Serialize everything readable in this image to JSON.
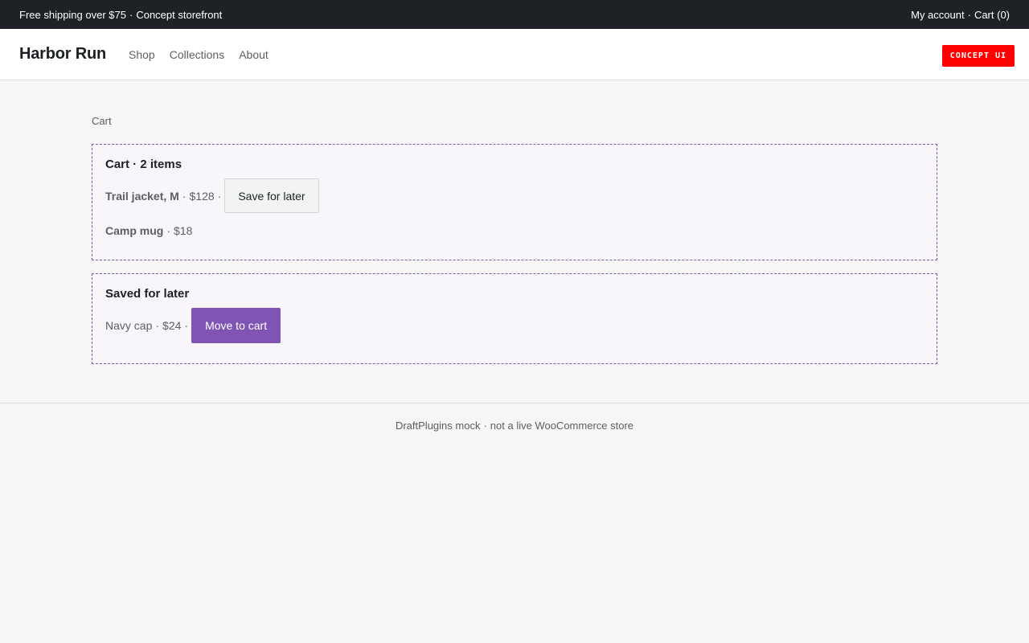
{
  "topbar": {
    "promo": "Free shipping over $75",
    "promo_sep": "·",
    "promo_tag": "Concept storefront",
    "account_link": "My account",
    "links_sep": "·",
    "cart_link": "Cart (0)"
  },
  "header": {
    "brand": "Harbor Run",
    "nav": [
      "Shop",
      "Collections",
      "About"
    ],
    "badge": "CONCEPT UI"
  },
  "breadcrumb": "Cart",
  "cart": {
    "title": "Cart · 2 items",
    "items": [
      {
        "name": "Trail jacket, M",
        "price": "$128",
        "action": "Save for later"
      },
      {
        "name": "Camp mug",
        "price": "$18"
      }
    ]
  },
  "saved": {
    "title": "Saved for later",
    "items": [
      {
        "name": "Navy cap",
        "price": "$24",
        "action": "Move to cart"
      }
    ]
  },
  "footer": {
    "left": "DraftPlugins mock",
    "sep": "·",
    "right": "not a live WooCommerce store"
  },
  "colors": {
    "topbar_bg": "#1e2226",
    "accent_purple": "#7f54b3",
    "badge_red": "#ff0000",
    "page_bg": "#f5f6f5"
  }
}
